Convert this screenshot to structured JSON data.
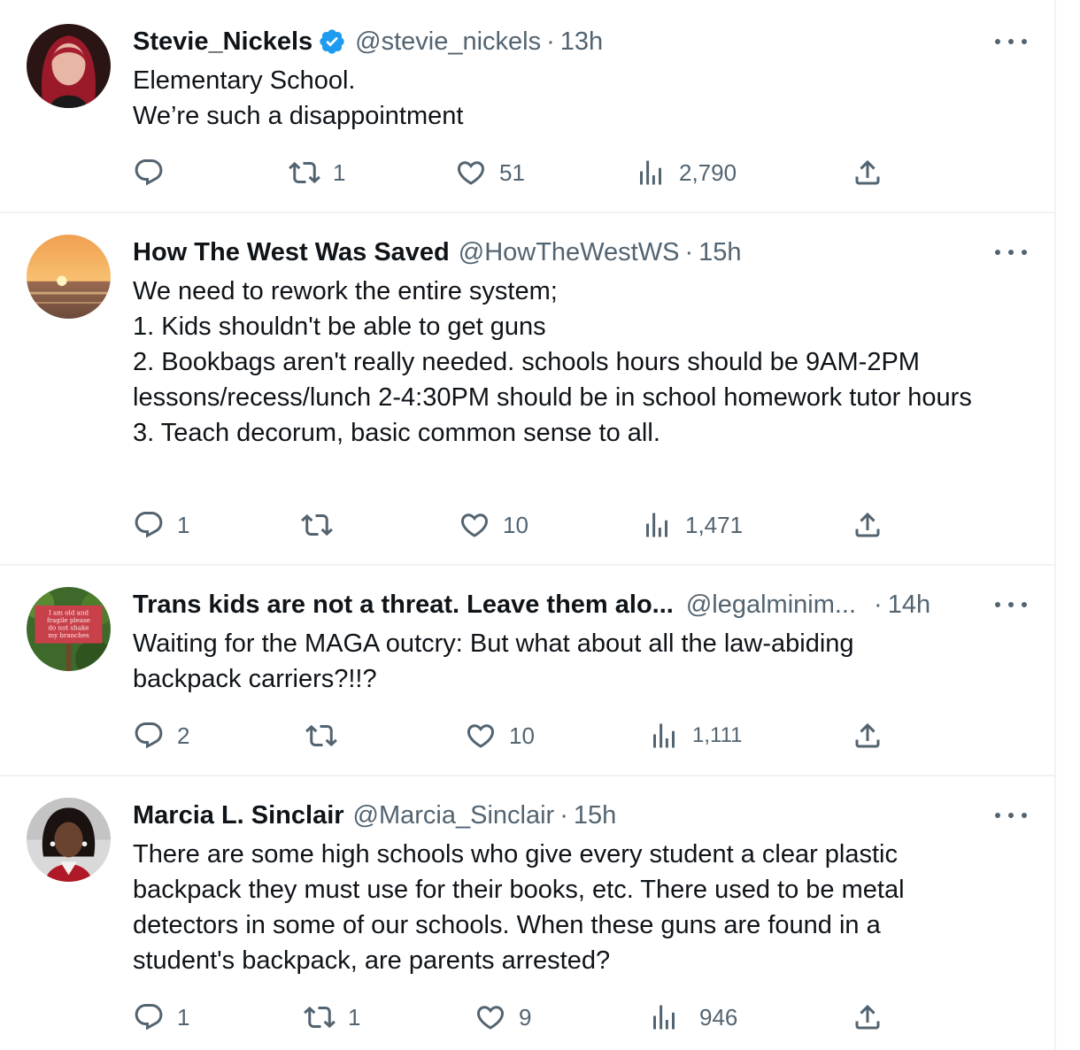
{
  "tweets": [
    {
      "name": "Stevie_Nickels",
      "verified": true,
      "handle": "@stevie_nickels",
      "separator": "·",
      "time": "13h",
      "text": "Elementary School.\nWe’re such a disappointment",
      "replies": "",
      "retweets": "1",
      "likes": "51",
      "views": "2,790",
      "avatar_icon": "woman-red-hair-avatar"
    },
    {
      "name": "How The West Was Saved",
      "verified": false,
      "handle": "@HowTheWestWS",
      "separator": "·",
      "time": "15h",
      "text": "We need to rework the entire system;\n1. Kids shouldn't be able to get guns\n2. Bookbags aren't really needed. schools hours should be 9AM-2PM lessons/recess/lunch 2-4:30PM should be in school homework tutor hours\n3. Teach decorum, basic common sense to all.",
      "replies": "1",
      "retweets": "",
      "likes": "10",
      "views": "1,471",
      "avatar_icon": "sunset-beach-avatar"
    },
    {
      "name": "Trans kids are not a threat. Leave them alo...",
      "verified": false,
      "handle": "@legalminim...",
      "separator": "·",
      "time": "14h",
      "text": "Waiting for the MAGA outcry: But what about all the law-abiding backpack carriers?!!?",
      "replies": "2",
      "retweets": "",
      "likes": "10",
      "views": "1,111",
      "avatar_icon": "garden-sign-avatar",
      "avatar_sign_text": "I am old and fragile please do not shake my branches"
    },
    {
      "name": "Marcia L. Sinclair",
      "verified": false,
      "handle": "@Marcia_Sinclair",
      "separator": "·",
      "time": "15h",
      "text": "There are some high schools who give every student a clear plastic backpack they must use for their books, etc. There used to be metal detectors in some of our schools. When these guns are found in a student's backpack, are parents arrested?",
      "replies": "1",
      "retweets": "1",
      "likes": "9",
      "views": "946",
      "avatar_icon": "woman-portrait-avatar"
    }
  ],
  "colors": {
    "text": "#0f1419",
    "secondary": "#536471",
    "verified": "#1d9bf0",
    "divider": "#eff3f4"
  }
}
